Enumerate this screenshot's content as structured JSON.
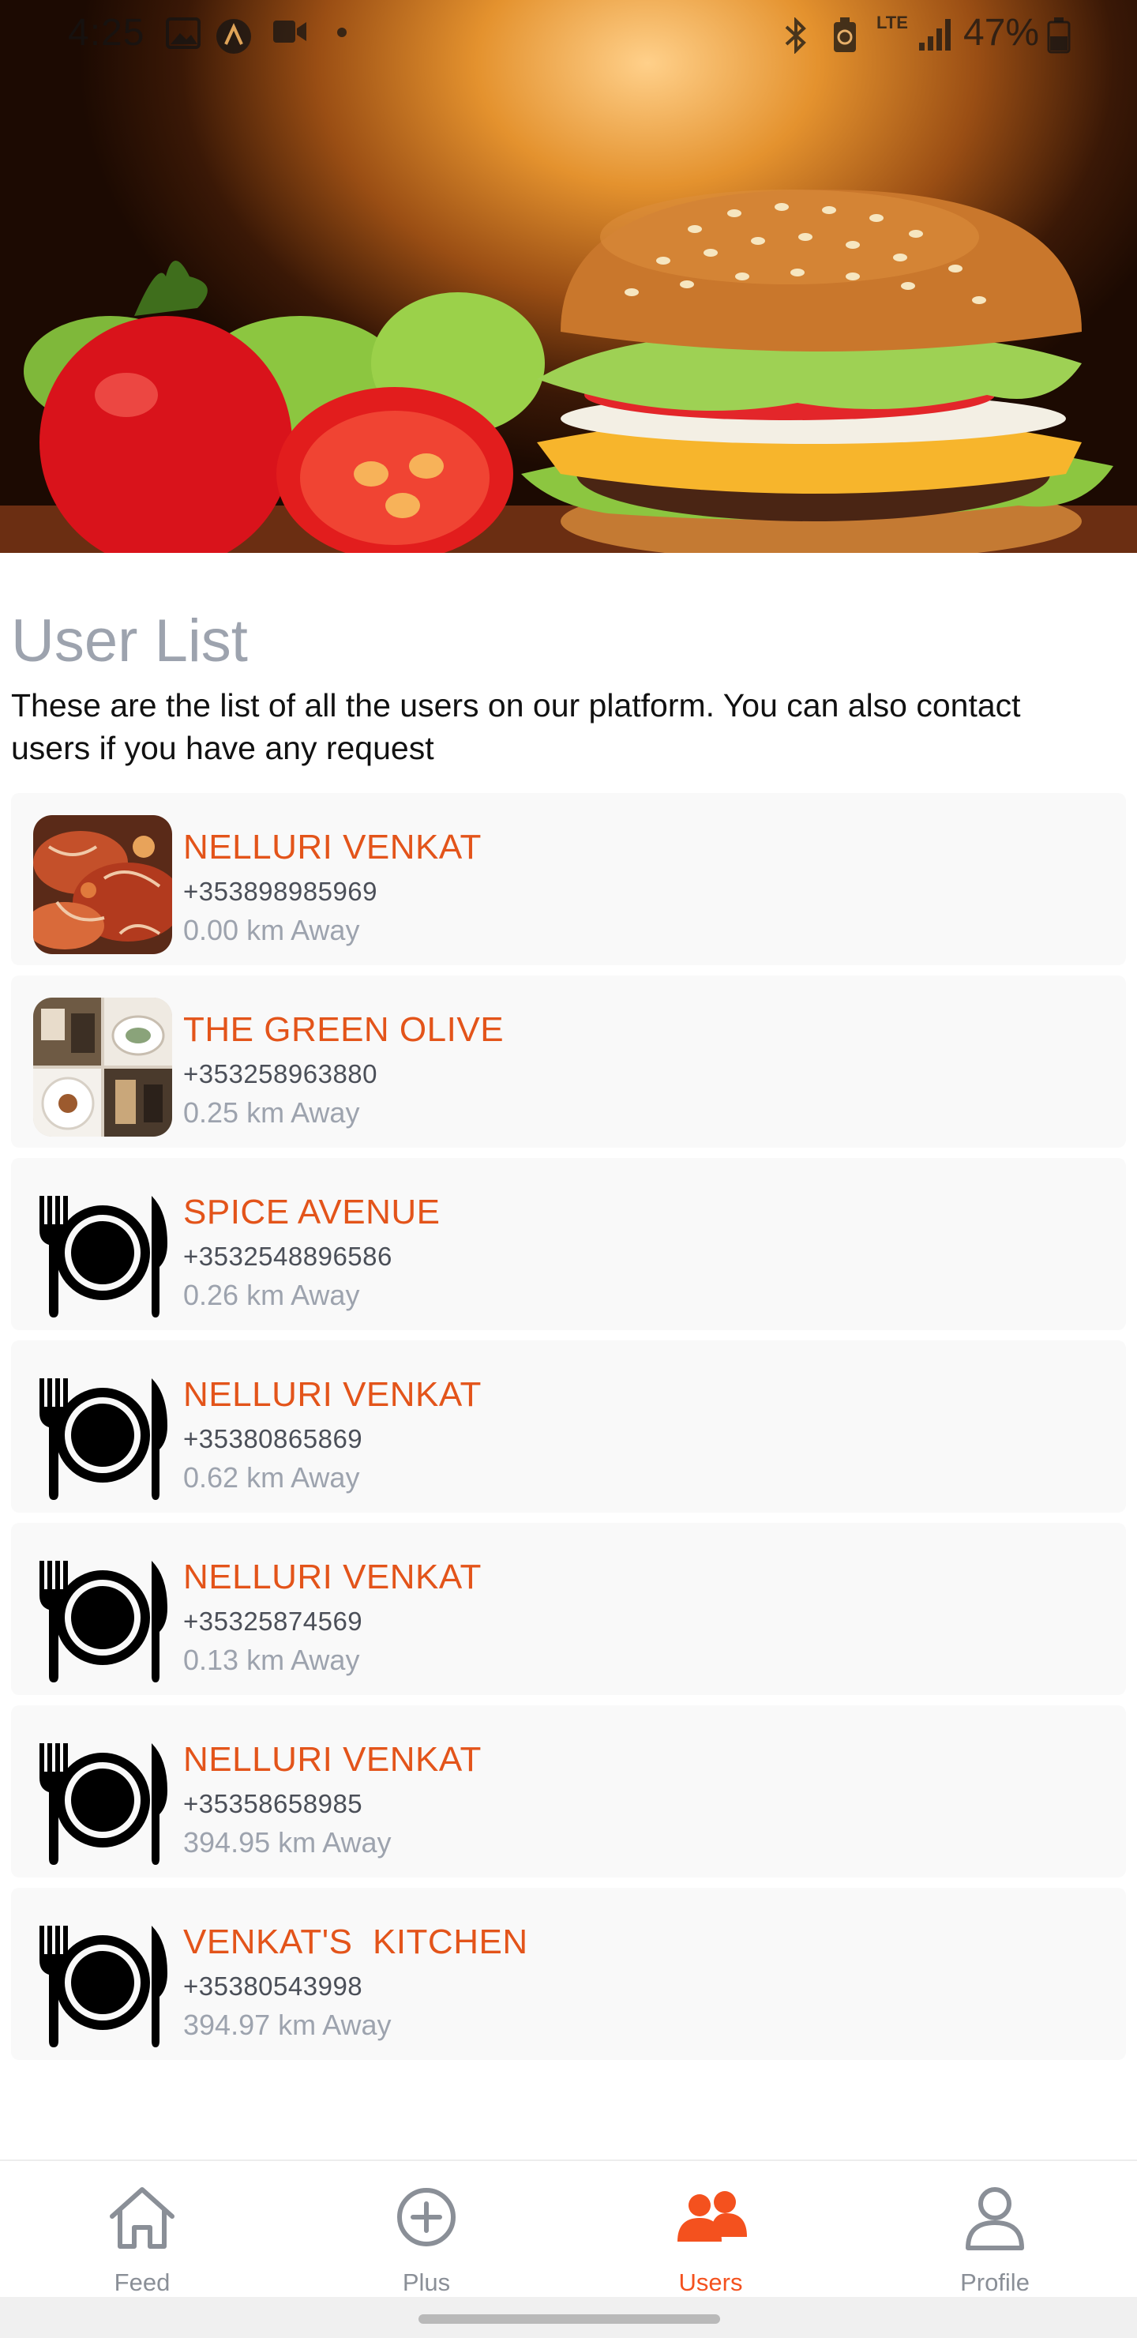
{
  "status_bar": {
    "time": "4:25",
    "network": "LTE",
    "battery": "47%"
  },
  "header": {
    "title": "User List",
    "subtitle": "These are the list of all the users on our platform. You can also contact users if you have any request"
  },
  "users": [
    {
      "name": "NELLURI VENKAT",
      "phone": "+353898985969",
      "distance": "0.00 km Away",
      "thumb": "food-photo"
    },
    {
      "name": "THE GREEN OLIVE",
      "phone": "+353258963880",
      "distance": "0.25 km Away",
      "thumb": "restaurant-photo"
    },
    {
      "name": "SPICE AVENUE",
      "phone": "+3532548896586",
      "distance": "0.26 km Away",
      "thumb": "plate-cutlery-icon"
    },
    {
      "name": "NELLURI VENKAT",
      "phone": "+35380865869",
      "distance": "0.62 km Away",
      "thumb": "plate-cutlery-icon"
    },
    {
      "name": "NELLURI VENKAT",
      "phone": "+35325874569",
      "distance": "0.13 km Away",
      "thumb": "plate-cutlery-icon"
    },
    {
      "name": "NELLURI VENKAT",
      "phone": "+35358658985",
      "distance": "394.95 km Away",
      "thumb": "plate-cutlery-icon"
    },
    {
      "name": "VENKAT'S  KITCHEN",
      "phone": "+35380543998",
      "distance": "394.97 km Away",
      "thumb": "plate-cutlery-icon"
    }
  ],
  "nav": {
    "active": "users",
    "items": [
      {
        "id": "feed",
        "label": "Feed",
        "icon": "home-icon"
      },
      {
        "id": "plus",
        "label": "Plus",
        "icon": "plus-circle-icon"
      },
      {
        "id": "users",
        "label": "Users",
        "icon": "users-icon"
      },
      {
        "id": "profile",
        "label": "Profile",
        "icon": "person-icon"
      }
    ]
  },
  "colors": {
    "accent": "#f4511e",
    "name_text": "#e3541a",
    "muted_text": "#9da3ae",
    "card_bg": "#f9f9f9"
  }
}
